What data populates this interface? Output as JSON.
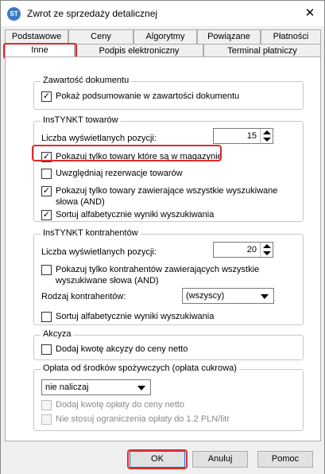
{
  "window": {
    "title": "Zwrot ze sprzedaży detalicznej",
    "app_icon_text": "ST",
    "close_glyph": "✕"
  },
  "tabs": {
    "row1": [
      "Podstawowe",
      "Ceny",
      "Algorytmy",
      "Powiązane",
      "Płatności"
    ],
    "row2": [
      "Inne",
      "Podpis elektroniczny",
      "Terminal płatniczy"
    ],
    "active": "Inne"
  },
  "groups": {
    "document": {
      "title": "Zawartość dokumentu",
      "show_summary": {
        "label": "Pokaż podsumowanie w zawartości dokumentu",
        "checked": true
      }
    },
    "products": {
      "title": "InsTYNKT towarów",
      "count_label": "Liczba wyświetlanych pozycji:",
      "count_value": "15",
      "only_in_stock": {
        "label": "Pokazuj tylko towary które są w magazynie",
        "checked": true
      },
      "reservations": {
        "label": "Uwzględniaj rezerwacje towarów",
        "checked": false
      },
      "all_words_line1": "Pokazuj tylko towary zawierające wszystkie wyszukiwane",
      "all_words_line2": "słowa (AND)",
      "all_words_checked": true,
      "sort_alpha": {
        "label": "Sortuj alfabetycznie wyniki wyszukiwania",
        "checked": true
      }
    },
    "contractors": {
      "title": "InsTYNKT kontrahentów",
      "count_label": "Liczba wyświetlanych pozycji:",
      "count_value": "20",
      "all_words_line1": "Pokazuj tylko kontrahentów zawierających wszystkie",
      "all_words_line2": "wyszukiwane słowa (AND)",
      "all_words_checked": false,
      "type_label": "Rodzaj kontrahentów:",
      "type_value": "(wszyscy)",
      "sort_alpha": {
        "label": "Sortuj alfabetycznie wyniki wyszukiwania",
        "checked": false
      }
    },
    "excise": {
      "title": "Akcyza",
      "add_excise": {
        "label": "Dodaj kwotę akcyzy do ceny netto",
        "checked": false
      }
    },
    "sugar_fee": {
      "title": "Opłata od środków spożywczych (opłata cukrowa)",
      "select_value": "nie naliczaj",
      "add_fee": {
        "label": "Dodaj kwotę opłaty do ceny netto",
        "checked": false
      },
      "no_limit": {
        "label": "Nie stosuj ograniczenia opłaty do 1.2 PLN/litr",
        "checked": false
      }
    }
  },
  "buttons": {
    "ok": "OK",
    "cancel": "Anuluj",
    "help": "Pomoc"
  },
  "colors": {
    "highlight": "#e22a2a",
    "focus_blue": "#0078d7"
  }
}
